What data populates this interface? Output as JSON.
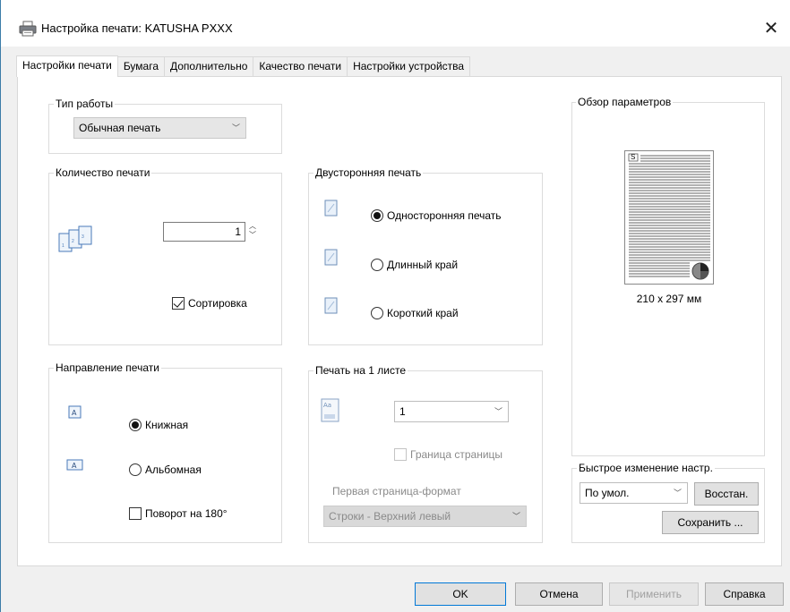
{
  "window": {
    "title": "Настройка печати: KATUSHA PXXX",
    "close_glyph": "✕"
  },
  "tabs": [
    {
      "label": "Настройки печати",
      "active": true
    },
    {
      "label": "Бумага",
      "active": false
    },
    {
      "label": "Дополнительно",
      "active": false
    },
    {
      "label": "Качество печати",
      "active": false
    },
    {
      "label": "Настройки устройства",
      "active": false
    }
  ],
  "job_type": {
    "title": "Тип работы",
    "selected": "Обычная печать"
  },
  "copies": {
    "title": "Количество печати",
    "value": "1",
    "collate_label": "Сортировка",
    "collate_checked": true
  },
  "duplex": {
    "title": "Двусторонняя печать",
    "options": [
      {
        "label": "Односторонняя печать",
        "selected": true
      },
      {
        "label": "Длинный край",
        "selected": false
      },
      {
        "label": "Короткий край",
        "selected": false
      }
    ]
  },
  "orientation": {
    "title": "Направление печати",
    "options": [
      {
        "label": "Книжная",
        "selected": true
      },
      {
        "label": "Альбомная",
        "selected": false
      }
    ],
    "rotate_label": "Поворот на 180°",
    "rotate_checked": false
  },
  "nup": {
    "title": "Печать на 1 листе",
    "selected": "1",
    "border_label": "Граница страницы",
    "order_label": "Первая страница-формат",
    "order_selected": "Строки - Верхний левый"
  },
  "preview": {
    "title": "Обзор параметров",
    "page_letter": "S",
    "size_text": "210 x 297 мм"
  },
  "quick": {
    "title": "Быстрое изменение настр.",
    "selected": "По умол.",
    "restore_label": "Восстан.",
    "save_label": "Сохранить ..."
  },
  "footer": {
    "ok_label": "OK",
    "cancel_label": "Отмена",
    "apply_label": "Применить",
    "help_label": "Справка"
  },
  "colors": {
    "accent": "#0078d7",
    "window_border": "#3c7ca8"
  }
}
